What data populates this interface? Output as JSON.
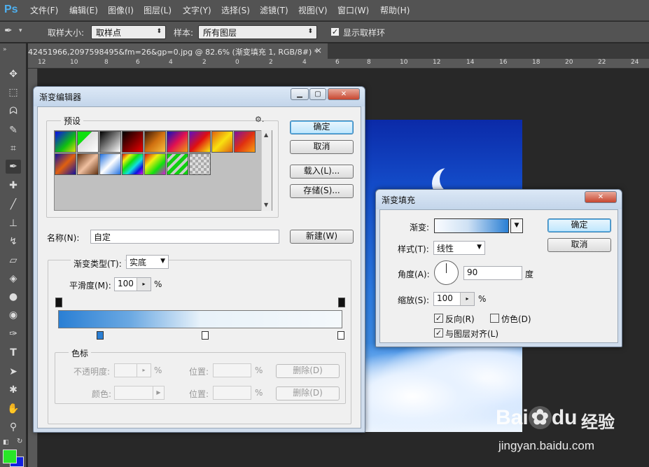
{
  "app": {
    "logo": "Ps"
  },
  "menu": [
    "文件(F)",
    "编辑(E)",
    "图像(I)",
    "图层(L)",
    "文字(Y)",
    "选择(S)",
    "滤镜(T)",
    "视图(V)",
    "窗口(W)",
    "帮助(H)"
  ],
  "options": {
    "sample_size_label": "取样大小:",
    "sample_size_value": "取样点",
    "sample_label": "样本:",
    "sample_value": "所有图层",
    "show_ring": "显示取样环"
  },
  "doc_tab": {
    "title": "42451966,2097598495&fm=26&gp=0.jpg @ 82.6% (渐变填充 1, RGB/8#) *",
    "close": "×",
    "collapse": "»"
  },
  "ruler": [
    "12",
    "10",
    "8",
    "6",
    "4",
    "2",
    "0",
    "2",
    "4",
    "6",
    "8",
    "10",
    "12",
    "14",
    "16",
    "18",
    "20",
    "22",
    "24"
  ],
  "gradient_editor": {
    "title": "渐变编辑器",
    "presets_label": "预设",
    "ok": "确定",
    "cancel": "取消",
    "load": "载入(L)...",
    "save": "存储(S)...",
    "name_label": "名称(N):",
    "name_value": "自定",
    "new": "新建(W)",
    "type_label": "渐变类型(T):",
    "type_value": "实底",
    "smooth_label": "平滑度(M):",
    "smooth_value": "100",
    "smooth_unit": "%",
    "color_stop_label": "色标",
    "opacity_label": "不透明度:",
    "opacity_unit": "%",
    "location_label": "位置:",
    "location_unit": "%",
    "delete": "删除(D)",
    "color_label": "颜色:",
    "gear": "⚙.",
    "gradient_colors": [
      "#2a7fd4",
      "#f4f8fb",
      "#f4f8fb"
    ]
  },
  "gradient_fill": {
    "title": "渐变填充",
    "gradient_label": "渐变:",
    "ok": "确定",
    "cancel": "取消",
    "style_label": "样式(T):",
    "style_value": "线性",
    "angle_label": "角度(A):",
    "angle_value": "90",
    "angle_unit": "度",
    "scale_label": "缩放(S):",
    "scale_value": "100",
    "scale_unit": "%",
    "reverse": "反向(R)",
    "dither": "仿色(D)",
    "align": "与图层对齐(L)"
  },
  "watermark": {
    "brand": "Bai",
    "brand2": "du",
    "jingyan": "经验",
    "url": "jingyan.baidu.com"
  },
  "colors": {
    "foreground": "#28e628",
    "background": "#1020e0"
  }
}
